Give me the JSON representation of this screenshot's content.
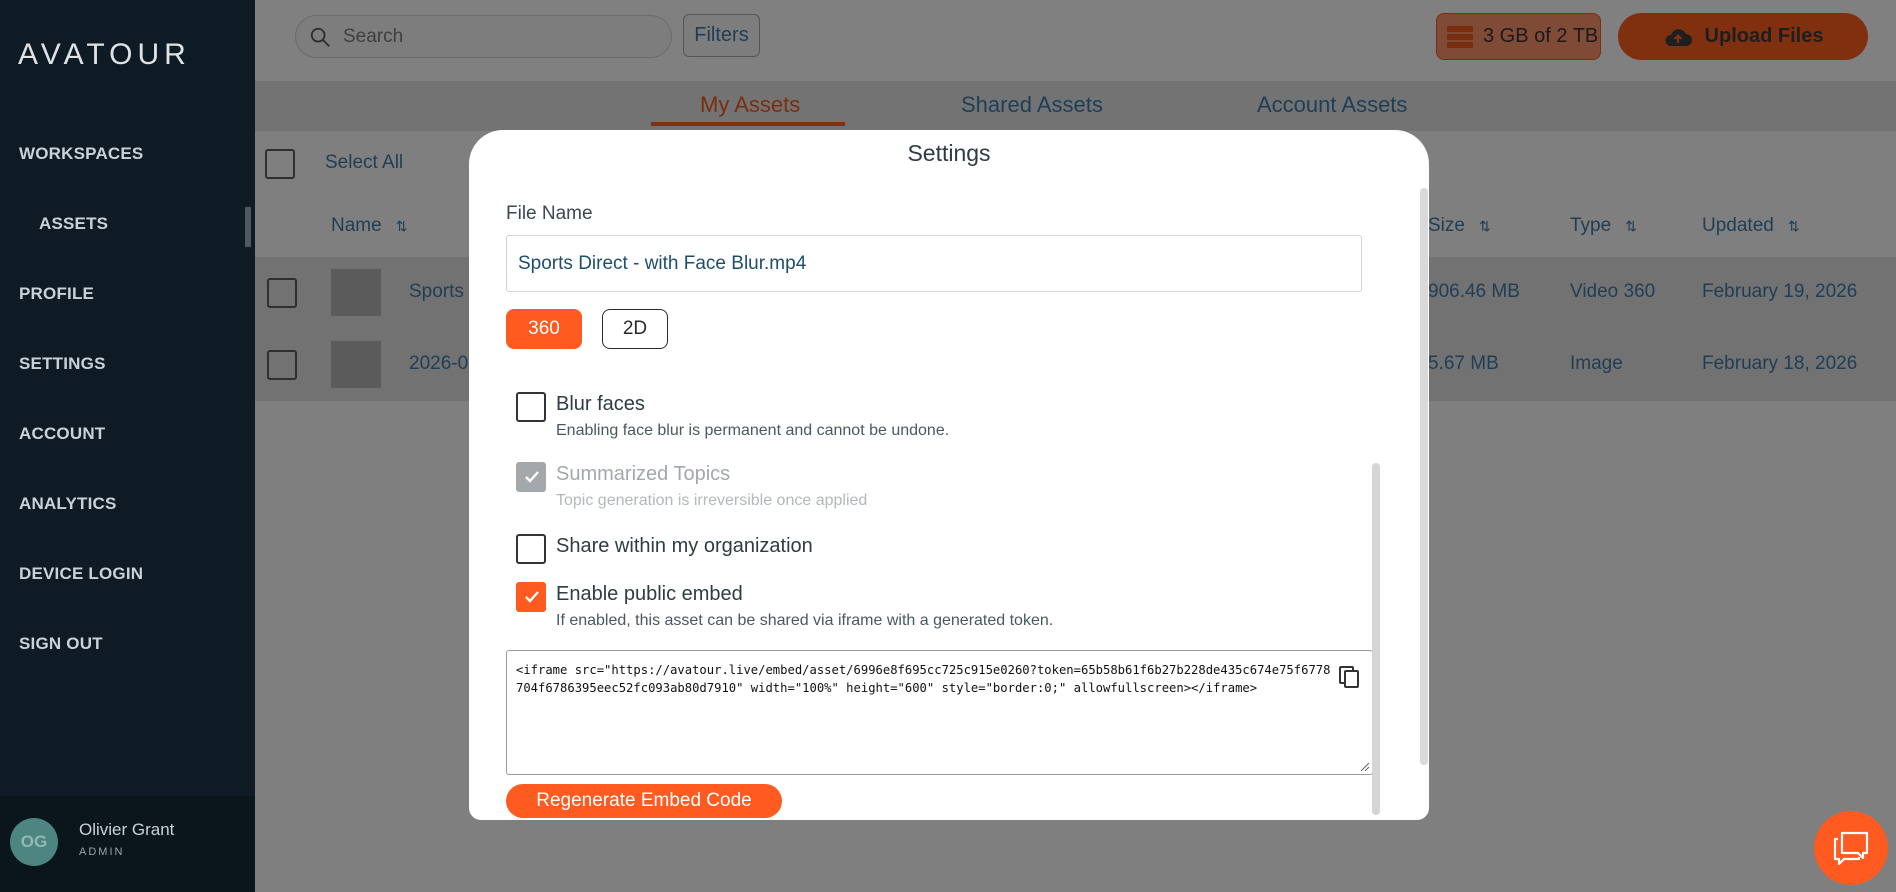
{
  "sidebar": {
    "logo": "AVATOUR",
    "items": [
      {
        "label": "WORKSPACES"
      },
      {
        "label": "ASSETS"
      },
      {
        "label": "PROFILE"
      },
      {
        "label": "SETTINGS"
      },
      {
        "label": "ACCOUNT"
      },
      {
        "label": "ANALYTICS"
      },
      {
        "label": "DEVICE LOGIN"
      },
      {
        "label": "SIGN OUT"
      }
    ],
    "user": {
      "initials": "OG",
      "name": "Olivier Grant",
      "role": "ADMIN"
    }
  },
  "header": {
    "search_placeholder": "Search",
    "filters_label": "Filters",
    "storage_text": "3 GB of 2 TB",
    "upload_label": "Upload Files"
  },
  "tabs": [
    {
      "label": "My Assets",
      "active": true
    },
    {
      "label": "Shared Assets",
      "active": false
    },
    {
      "label": "Account Assets",
      "active": false
    }
  ],
  "table": {
    "select_all_label": "Select All",
    "columns": {
      "name": "Name",
      "size": "Size",
      "type": "Type",
      "updated": "Updated"
    },
    "rows": [
      {
        "name": "Sports",
        "size": "906.46 MB",
        "type": "Video 360",
        "updated": "February 19, 2026"
      },
      {
        "name": "2026-0",
        "size": "5.67 MB",
        "type": "Image",
        "updated": "February 18, 2026"
      }
    ]
  },
  "modal": {
    "title": "Settings",
    "file_name_label": "File Name",
    "file_name_value": "Sports Direct - with Face Blur.mp4",
    "mode_360": "360",
    "mode_2d": "2D",
    "options": {
      "blur": {
        "title": "Blur faces",
        "desc": "Enabling face blur is permanent and cannot be undone.",
        "checked": false
      },
      "topics": {
        "title": "Summarized Topics",
        "desc": "Topic generation is irreversible once applied",
        "checked": true,
        "disabled": true
      },
      "share": {
        "title": "Share within my organization",
        "checked": false
      },
      "embed": {
        "title": "Enable public embed",
        "desc": "If enabled, this asset can be shared via iframe with a generated token.",
        "checked": true
      }
    },
    "embed_code": "<iframe src=\"https://avatour.live/embed/asset/6996e8f695cc725c915e0260?token=65b58b61f6b27b228de435c674e75f6778704f6786395eec52fc093ab80d7910\" width=\"100%\" height=\"600\" style=\"border:0;\" allowfullscreen></iframe>",
    "regen_label": "Regenerate Embed Code"
  },
  "colors": {
    "accent": "#ff5a1f",
    "sidebar_bg": "#0f1b24",
    "text_primary": "#1f3e55"
  }
}
